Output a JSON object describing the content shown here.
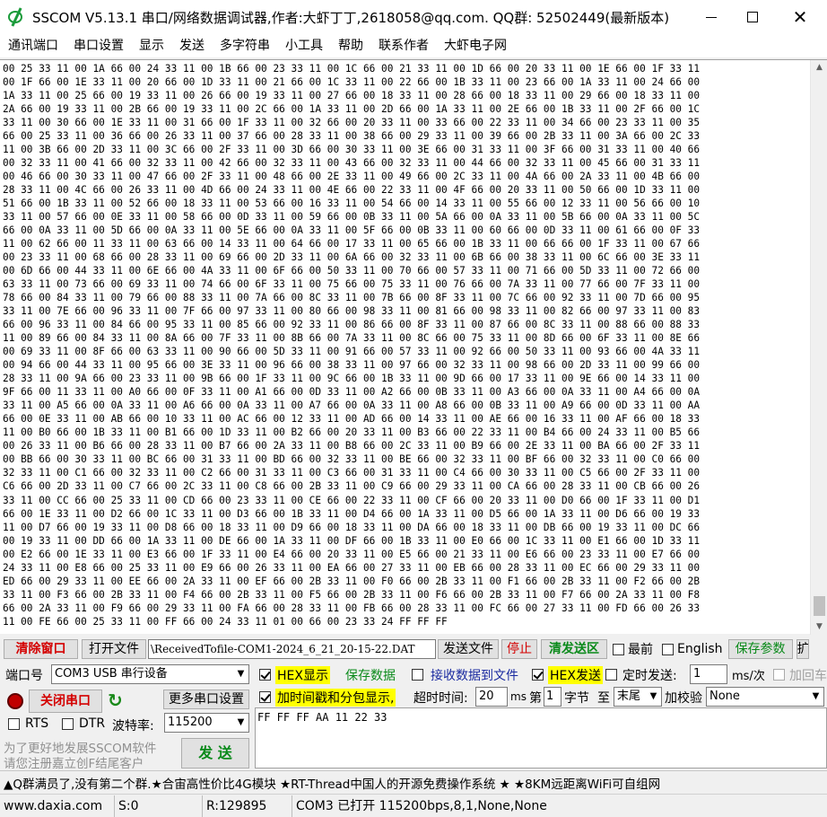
{
  "window": {
    "title": "SSCOM V5.13.1 串口/网络数据调试器,作者:大虾丁丁,2618058@qq.com. QQ群: 52502449(最新版本)",
    "app_icon": "sscom-app-icon",
    "min_glyph": "",
    "max_glyph": "",
    "close_glyph": "✕"
  },
  "menu": [
    "通讯端口",
    "串口设置",
    "显示",
    "发送",
    "多字符串",
    "小工具",
    "帮助",
    "联系作者",
    "大虾电子网"
  ],
  "receive": {
    "lines": [
      "00 25 33 11 00 1A 66 00 24 33 11 00 1B 66 00 23 33 11 00 1C 66 00 21 33 11 00 1D 66 00 20 33 11 00 1E 66 00 1F 33 11",
      "00 1F 66 00 1E 33 11 00 20 66 00 1D 33 11 00 21 66 00 1C 33 11 00 22 66 00 1B 33 11 00 23 66 00 1A 33 11 00 24 66 00",
      "1A 33 11 00 25 66 00 19 33 11 00 26 66 00 19 33 11 00 27 66 00 18 33 11 00 28 66 00 18 33 11 00 29 66 00 18 33 11 00",
      "2A 66 00 19 33 11 00 2B 66 00 19 33 11 00 2C 66 00 1A 33 11 00 2D 66 00 1A 33 11 00 2E 66 00 1B 33 11 00 2F 66 00 1C",
      "33 11 00 30 66 00 1E 33 11 00 31 66 00 1F 33 11 00 32 66 00 20 33 11 00 33 66 00 22 33 11 00 34 66 00 23 33 11 00 35",
      "66 00 25 33 11 00 36 66 00 26 33 11 00 37 66 00 28 33 11 00 38 66 00 29 33 11 00 39 66 00 2B 33 11 00 3A 66 00 2C 33",
      "11 00 3B 66 00 2D 33 11 00 3C 66 00 2F 33 11 00 3D 66 00 30 33 11 00 3E 66 00 31 33 11 00 3F 66 00 31 33 11 00 40 66",
      "00 32 33 11 00 41 66 00 32 33 11 00 42 66 00 32 33 11 00 43 66 00 32 33 11 00 44 66 00 32 33 11 00 45 66 00 31 33 11",
      "00 46 66 00 30 33 11 00 47 66 00 2F 33 11 00 48 66 00 2E 33 11 00 49 66 00 2C 33 11 00 4A 66 00 2A 33 11 00 4B 66 00",
      "28 33 11 00 4C 66 00 26 33 11 00 4D 66 00 24 33 11 00 4E 66 00 22 33 11 00 4F 66 00 20 33 11 00 50 66 00 1D 33 11 00",
      "51 66 00 1B 33 11 00 52 66 00 18 33 11 00 53 66 00 16 33 11 00 54 66 00 14 33 11 00 55 66 00 12 33 11 00 56 66 00 10",
      "33 11 00 57 66 00 0E 33 11 00 58 66 00 0D 33 11 00 59 66 00 0B 33 11 00 5A 66 00 0A 33 11 00 5B 66 00 0A 33 11 00 5C",
      "66 00 0A 33 11 00 5D 66 00 0A 33 11 00 5E 66 00 0A 33 11 00 5F 66 00 0B 33 11 00 60 66 00 0D 33 11 00 61 66 00 0F 33",
      "11 00 62 66 00 11 33 11 00 63 66 00 14 33 11 00 64 66 00 17 33 11 00 65 66 00 1B 33 11 00 66 66 00 1F 33 11 00 67 66",
      "00 23 33 11 00 68 66 00 28 33 11 00 69 66 00 2D 33 11 00 6A 66 00 32 33 11 00 6B 66 00 38 33 11 00 6C 66 00 3E 33 11",
      "00 6D 66 00 44 33 11 00 6E 66 00 4A 33 11 00 6F 66 00 50 33 11 00 70 66 00 57 33 11 00 71 66 00 5D 33 11 00 72 66 00",
      "63 33 11 00 73 66 00 69 33 11 00 74 66 00 6F 33 11 00 75 66 00 75 33 11 00 76 66 00 7A 33 11 00 77 66 00 7F 33 11 00",
      "78 66 00 84 33 11 00 79 66 00 88 33 11 00 7A 66 00 8C 33 11 00 7B 66 00 8F 33 11 00 7C 66 00 92 33 11 00 7D 66 00 95",
      "33 11 00 7E 66 00 96 33 11 00 7F 66 00 97 33 11 00 80 66 00 98 33 11 00 81 66 00 98 33 11 00 82 66 00 97 33 11 00 83",
      "66 00 96 33 11 00 84 66 00 95 33 11 00 85 66 00 92 33 11 00 86 66 00 8F 33 11 00 87 66 00 8C 33 11 00 88 66 00 88 33",
      "11 00 89 66 00 84 33 11 00 8A 66 00 7F 33 11 00 8B 66 00 7A 33 11 00 8C 66 00 75 33 11 00 8D 66 00 6F 33 11 00 8E 66",
      "00 69 33 11 00 8F 66 00 63 33 11 00 90 66 00 5D 33 11 00 91 66 00 57 33 11 00 92 66 00 50 33 11 00 93 66 00 4A 33 11",
      "00 94 66 00 44 33 11 00 95 66 00 3E 33 11 00 96 66 00 38 33 11 00 97 66 00 32 33 11 00 98 66 00 2D 33 11 00 99 66 00",
      "28 33 11 00 9A 66 00 23 33 11 00 9B 66 00 1F 33 11 00 9C 66 00 1B 33 11 00 9D 66 00 17 33 11 00 9E 66 00 14 33 11 00",
      "9F 66 00 11 33 11 00 A0 66 00 0F 33 11 00 A1 66 00 0D 33 11 00 A2 66 00 0B 33 11 00 A3 66 00 0A 33 11 00 A4 66 00 0A",
      "33 11 00 A5 66 00 0A 33 11 00 A6 66 00 0A 33 11 00 A7 66 00 0A 33 11 00 A8 66 00 0B 33 11 00 A9 66 00 0D 33 11 00 AA",
      "66 00 0E 33 11 00 AB 66 00 10 33 11 00 AC 66 00 12 33 11 00 AD 66 00 14 33 11 00 AE 66 00 16 33 11 00 AF 66 00 18 33",
      "11 00 B0 66 00 1B 33 11 00 B1 66 00 1D 33 11 00 B2 66 00 20 33 11 00 B3 66 00 22 33 11 00 B4 66 00 24 33 11 00 B5 66",
      "00 26 33 11 00 B6 66 00 28 33 11 00 B7 66 00 2A 33 11 00 B8 66 00 2C 33 11 00 B9 66 00 2E 33 11 00 BA 66 00 2F 33 11",
      "00 BB 66 00 30 33 11 00 BC 66 00 31 33 11 00 BD 66 00 32 33 11 00 BE 66 00 32 33 11 00 BF 66 00 32 33 11 00 C0 66 00",
      "32 33 11 00 C1 66 00 32 33 11 00 C2 66 00 31 33 11 00 C3 66 00 31 33 11 00 C4 66 00 30 33 11 00 C5 66 00 2F 33 11 00",
      "C6 66 00 2D 33 11 00 C7 66 00 2C 33 11 00 C8 66 00 2B 33 11 00 C9 66 00 29 33 11 00 CA 66 00 28 33 11 00 CB 66 00 26",
      "33 11 00 CC 66 00 25 33 11 00 CD 66 00 23 33 11 00 CE 66 00 22 33 11 00 CF 66 00 20 33 11 00 D0 66 00 1F 33 11 00 D1",
      "66 00 1E 33 11 00 D2 66 00 1C 33 11 00 D3 66 00 1B 33 11 00 D4 66 00 1A 33 11 00 D5 66 00 1A 33 11 00 D6 66 00 19 33",
      "11 00 D7 66 00 19 33 11 00 D8 66 00 18 33 11 00 D9 66 00 18 33 11 00 DA 66 00 18 33 11 00 DB 66 00 19 33 11 00 DC 66",
      "00 19 33 11 00 DD 66 00 1A 33 11 00 DE 66 00 1A 33 11 00 DF 66 00 1B 33 11 00 E0 66 00 1C 33 11 00 E1 66 00 1D 33 11",
      "00 E2 66 00 1E 33 11 00 E3 66 00 1F 33 11 00 E4 66 00 20 33 11 00 E5 66 00 21 33 11 00 E6 66 00 23 33 11 00 E7 66 00",
      "24 33 11 00 E8 66 00 25 33 11 00 E9 66 00 26 33 11 00 EA 66 00 27 33 11 00 EB 66 00 28 33 11 00 EC 66 00 29 33 11 00",
      "ED 66 00 29 33 11 00 EE 66 00 2A 33 11 00 EF 66 00 2B 33 11 00 F0 66 00 2B 33 11 00 F1 66 00 2B 33 11 00 F2 66 00 2B",
      "33 11 00 F3 66 00 2B 33 11 00 F4 66 00 2B 33 11 00 F5 66 00 2B 33 11 00 F6 66 00 2B 33 11 00 F7 66 00 2A 33 11 00 F8",
      "66 00 2A 33 11 00 F9 66 00 29 33 11 00 FA 66 00 28 33 11 00 FB 66 00 28 33 11 00 FC 66 00 27 33 11 00 FD 66 00 26 33",
      "11 00 FE 66 00 25 33 11 00 FF 66 00 24 33 11 01 00 66 00 23 33 24 FF FF FF"
    ]
  },
  "toolbar1": {
    "clear_window": "清除窗口",
    "open_file": "打开文件",
    "file_path": "\\ReceivedTofile-COM1-2024_6_21_20-15-22.DAT",
    "send_file": "发送文件",
    "stop": "停止",
    "clear_send": "清发送区",
    "topmost_label": "最前",
    "english_label": "English",
    "save_params": "保存参数",
    "expand": "扩"
  },
  "port": {
    "port_label": "端口号",
    "port_value": "COM3 USB 串行设备",
    "close_port": "关闭串口",
    "more_settings": "更多串口设置",
    "rts_label": "RTS",
    "dtr_label": "DTR",
    "baud_label": "波特率:",
    "baud_value": "115200",
    "promo_line1": "为了更好地发展SSCOM软件",
    "promo_line2": "请您注册嘉立创F结尾客户",
    "send_button": "发 送"
  },
  "options": {
    "hex_display": "HEX显示",
    "save_data": "保存数据",
    "recv_to_file": "接收数据到文件",
    "hex_send": "HEX发送",
    "timed_send": "定时发送:",
    "timed_ms": "1",
    "ms_per": "ms/次",
    "add_cr": "加回车",
    "add_timestamp": "加时间戳和分包显示,",
    "timeout_label": "超时时间:",
    "timeout_value": "20",
    "ms": "ms",
    "no_label": "第",
    "byte_index": "1",
    "byte_label": "字节",
    "to_label": "至",
    "to_value": "末尾",
    "checksum_label": "加校验",
    "checksum_value": "None"
  },
  "send_content": "FF FF FF AA 11 22 33",
  "adbar": "▲Q群满员了,没有第二个群.★合宙高性价比4G模块 ★RT-Thread中国人的开源免费操作系统 ★ ★8KM远距离WiFi可自组网",
  "status": {
    "site": "www.daxia.com",
    "sent": "S:0",
    "received": "R:129895",
    "port_state": "COM3 已打开  115200bps,8,1,None,None"
  },
  "colors": {
    "clear_red": "#d40000",
    "accent_green": "#0a8a1a",
    "highlight_yellow": "#ffff00"
  }
}
